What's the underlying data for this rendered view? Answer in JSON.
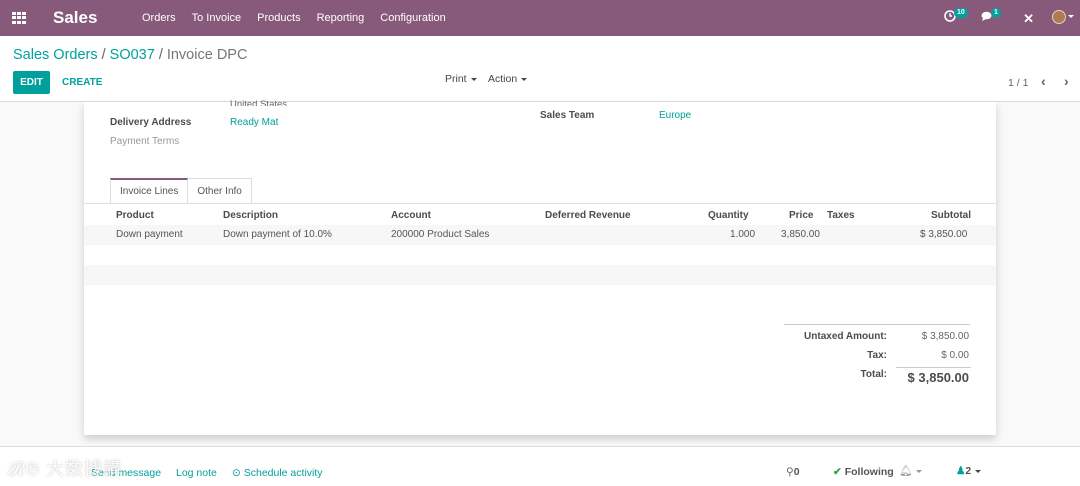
{
  "navbar": {
    "brand": "Sales",
    "menu": [
      "Orders",
      "To Invoice",
      "Products",
      "Reporting",
      "Configuration"
    ],
    "activity_count": "10",
    "message_count": "1",
    "bg_color": "#875a7b"
  },
  "breadcrumb": {
    "items": [
      "Sales Orders",
      "SO037"
    ],
    "current": "Invoice DPC"
  },
  "actions": {
    "edit": "EDIT",
    "create": "CREATE",
    "print": "Print",
    "action": "Action"
  },
  "pager": {
    "value": "1 / 1"
  },
  "form": {
    "partially_visible_text": "United States",
    "delivery_address_label": "Delivery Address",
    "delivery_address_value": "Ready Mat",
    "payment_terms_label": "Payment Terms",
    "sales_team_label": "Sales Team",
    "sales_team_value": "Europe"
  },
  "tabs": [
    {
      "label": "Invoice Lines",
      "active": true
    },
    {
      "label": "Other Info",
      "active": false
    }
  ],
  "table": {
    "columns": [
      "Product",
      "Description",
      "Account",
      "Deferred Revenue",
      "Quantity",
      "Price",
      "Taxes",
      "Subtotal"
    ],
    "rows": [
      {
        "product": "Down payment",
        "description": "Down payment of 10.0%",
        "account": "200000 Product Sales",
        "deferred_revenue": "",
        "quantity": "1.000",
        "price": "3,850.00",
        "taxes": "",
        "subtotal": "$ 3,850.00"
      }
    ]
  },
  "totals": {
    "untaxed_label": "Untaxed Amount:",
    "untaxed_value": "$ 3,850.00",
    "tax_label": "Tax:",
    "tax_value": "$ 0.00",
    "total_label": "Total:",
    "total_value": "$ 3,850.00"
  },
  "chatter": {
    "send_message": "Send message",
    "log_note": "Log note",
    "schedule_activity": "Schedule activity",
    "attachments_count": "0",
    "following": "Following",
    "followers_count": "2"
  },
  "watermark": "大数據講"
}
